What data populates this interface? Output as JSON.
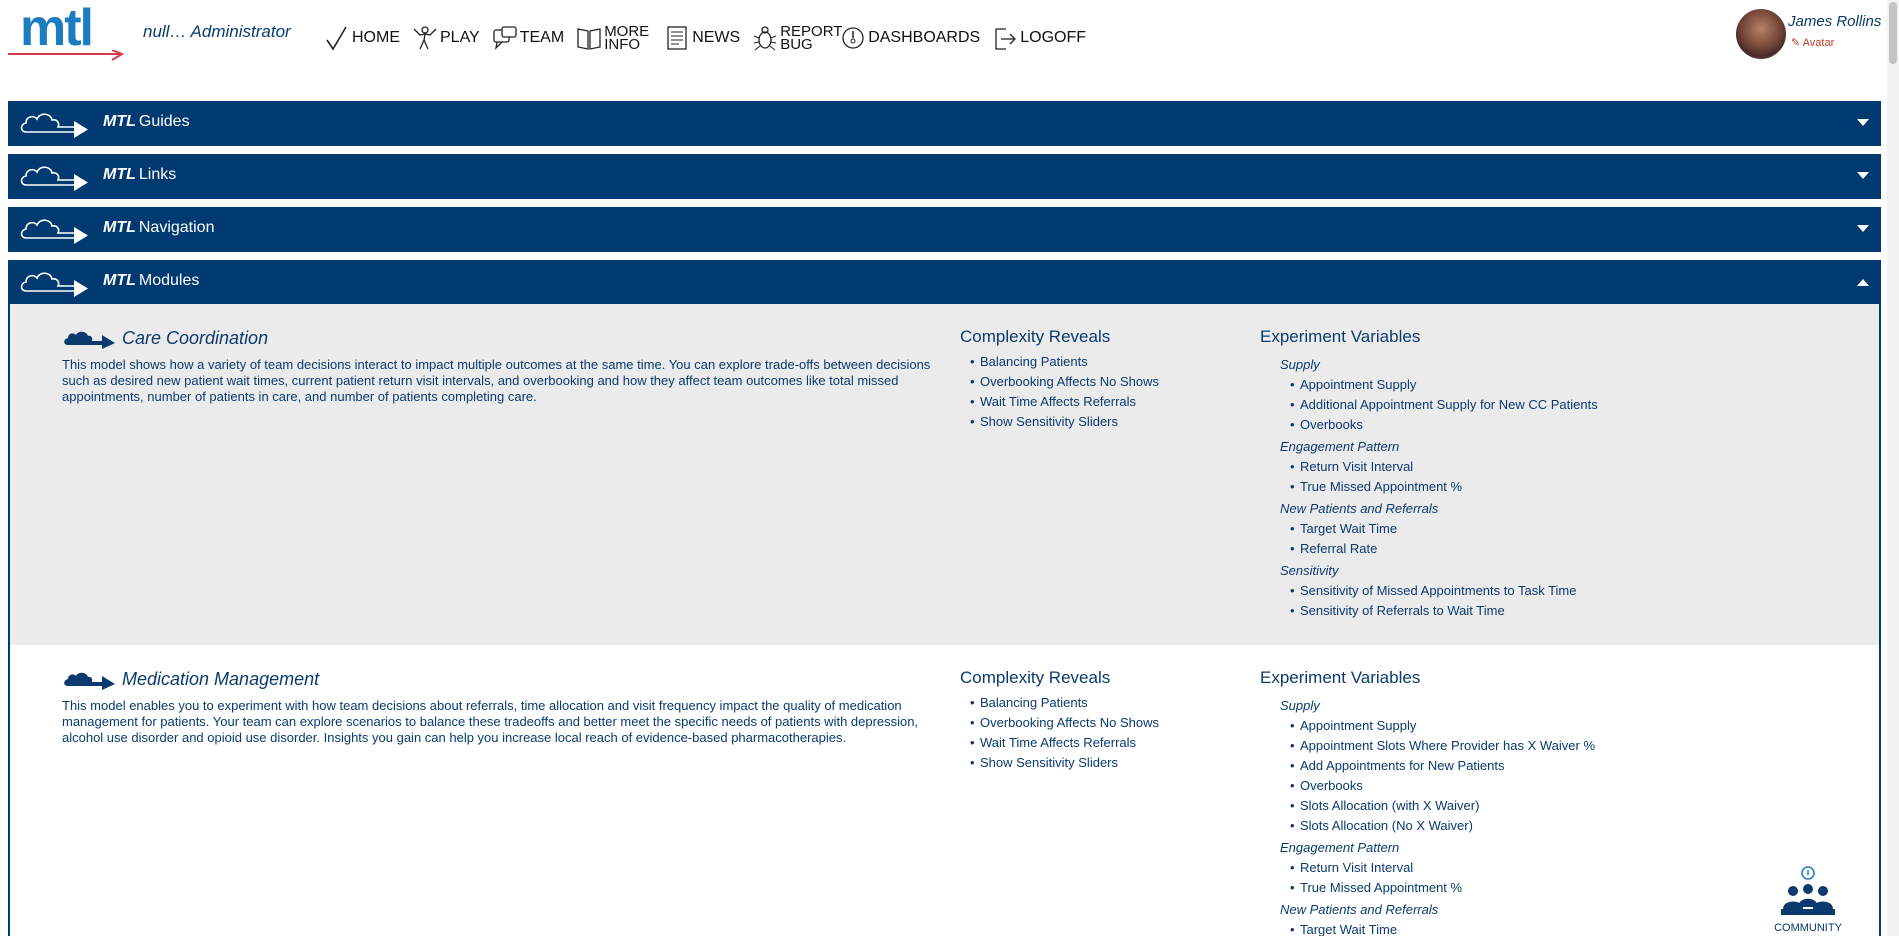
{
  "header": {
    "logo_text": "mtl",
    "user_role": "null… Administrator",
    "user_name": "James Rollins",
    "avatar_link": "Avatar"
  },
  "nav": {
    "home": "HOME",
    "play": "PLAY",
    "team": "TEAM",
    "more_info": "MORE INFO",
    "news": "NEWS",
    "report_bug": "REPORT BUG",
    "dashboards": "DASHBOARDS",
    "logoff": "LOGOFF"
  },
  "accordions": {
    "guides": {
      "brand": "MTL",
      "label": "Guides"
    },
    "links": {
      "brand": "MTL",
      "label": "Links"
    },
    "navigation": {
      "brand": "MTL",
      "label": "Navigation"
    },
    "modules": {
      "brand": "MTL",
      "label": "Modules"
    }
  },
  "modules": [
    {
      "title": "Care Coordination",
      "description": "This model shows how a variety of team decisions interact to impact multiple outcomes at the same time. You can explore trade-offs between decisions such as desired new patient wait times, current patient return visit intervals, and overbooking and how they affect team outcomes like total missed appointments, number of patients in care, and number of patients completing care.",
      "complexity_title": "Complexity Reveals",
      "complexity": [
        "Balancing Patients",
        "Overbooking Affects No Shows",
        "Wait Time Affects Referrals",
        "Show Sensitivity Sliders"
      ],
      "experiment_title": "Experiment Variables",
      "groups": [
        {
          "label": "Supply",
          "items": [
            "Appointment Supply",
            "Additional Appointment Supply for New CC Patients",
            "Overbooks"
          ]
        },
        {
          "label": "Engagement Pattern",
          "items": [
            "Return Visit Interval",
            "True Missed Appointment %"
          ]
        },
        {
          "label": "New Patients and Referrals",
          "items": [
            "Target Wait Time",
            "Referral Rate"
          ]
        },
        {
          "label": "Sensitivity",
          "items": [
            "Sensitivity of Missed Appointments to Task Time",
            "Sensitivity of Referrals to Wait Time"
          ]
        }
      ]
    },
    {
      "title": "Medication Management",
      "description": "This model enables you to experiment with how team decisions about referrals, time allocation and visit frequency impact the quality of medication management for patients. Your team can explore scenarios to balance these tradeoffs and better meet the specific needs of patients with depression, alcohol use disorder and opioid use disorder. Insights you gain can help you increase local reach of evidence-based pharmacotherapies.",
      "complexity_title": "Complexity Reveals",
      "complexity": [
        "Balancing Patients",
        "Overbooking Affects No Shows",
        "Wait Time Affects Referrals",
        "Show Sensitivity Sliders"
      ],
      "experiment_title": "Experiment Variables",
      "groups": [
        {
          "label": "Supply",
          "items": [
            "Appointment Supply",
            "Appointment Slots Where Provider has X Waiver %",
            "Add Appointments for New Patients",
            "Overbooks",
            "Slots Allocation (with X Waiver)",
            "Slots Allocation (No X Waiver)"
          ]
        },
        {
          "label": "Engagement Pattern",
          "items": [
            "Return Visit Interval",
            "True Missed Appointment %"
          ]
        },
        {
          "label": "New Patients and Referrals",
          "items": [
            "Target Wait Time"
          ]
        }
      ]
    }
  ],
  "community_label": "COMMUNITY",
  "colors": {
    "brand_blue": "#003a70",
    "logo_blue": "#1c7cc2",
    "accent_red": "#c0392b",
    "panel_gray": "#ebebeb"
  }
}
